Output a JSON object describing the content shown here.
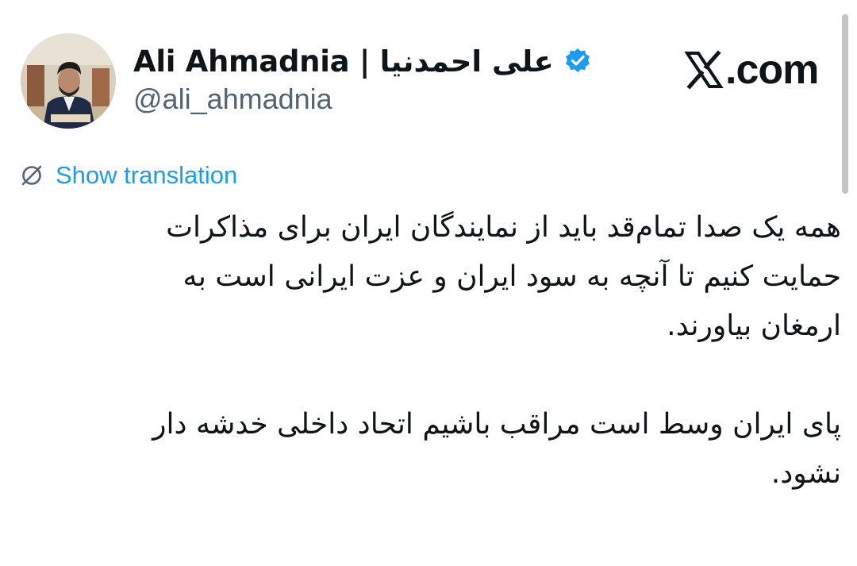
{
  "author": {
    "display_name": "Ali Ahmadnia | علی احمدنیا",
    "handle": "@ali_ahmadnia",
    "verified": true,
    "avatar_icon": "profile-photo"
  },
  "brand": {
    "x_icon": "x-logo-icon",
    "text": ".com"
  },
  "translation": {
    "icon": "globe-slash-icon",
    "label": "Show translation"
  },
  "tweet": {
    "paragraphs": [
      [
        "همه یک صدا تمام‌قد باید از نمایندگان ایران برای مذاکرات",
        "حمایت کنیم تا آنچه به سود ایران و عزت ایرانی است به",
        "ارمغان بیاورند."
      ],
      [
        "پای ایران وسط است مراقب باشیم اتحاد داخلی خدشه دار",
        "نشود."
      ]
    ]
  },
  "colors": {
    "accent": "#1d9bf0",
    "text": "#0f1419",
    "muted": "#536471"
  }
}
